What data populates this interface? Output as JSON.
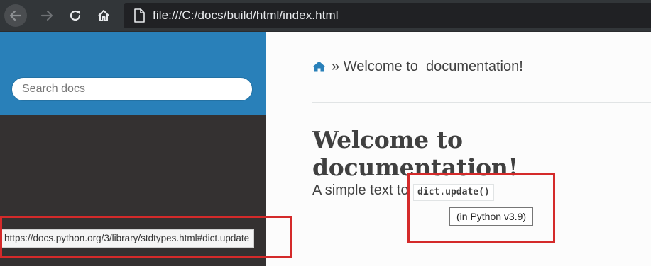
{
  "browser": {
    "url": "file:///C:/docs/build/html/index.html",
    "icons": [
      "back-arrow-icon",
      "forward-arrow-icon",
      "reload-icon",
      "home-icon",
      "page-icon"
    ]
  },
  "sidebar": {
    "search": {
      "placeholder": "Search docs",
      "value": ""
    },
    "colors": {
      "header_bg": "#2980b9",
      "body_bg": "#343131"
    }
  },
  "content": {
    "breadcrumb": {
      "separator": "»",
      "current": "Welcome to  documentation!"
    },
    "title": "Welcome to documentation!",
    "paragraph": "A simple text to",
    "code_ref": "dict.update()",
    "tooltip": "(in Python v3.9)"
  },
  "status_bar": {
    "link_url": "https://docs.python.org/3/library/stdtypes.html#dict.update"
  },
  "annotations": {
    "highlight_color": "#d42a2a"
  }
}
